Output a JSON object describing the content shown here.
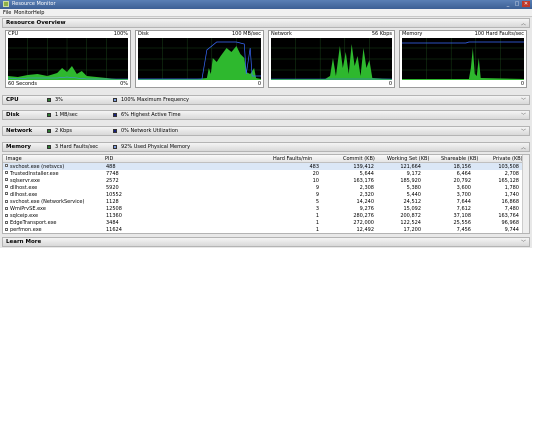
{
  "window": {
    "title": "Resource Monitor",
    "controls": [
      "_",
      "□",
      "✕"
    ]
  },
  "menu": {
    "items": [
      "File",
      "Monitor",
      "Help"
    ]
  },
  "overview": {
    "title": "Resource Overview",
    "graphs": {
      "cpu": {
        "title": "CPU",
        "top_right": "100%",
        "bottom_left": "60 Seconds",
        "bottom_right": "0%"
      },
      "disk": {
        "title": "Disk",
        "top_right": "100 MB/sec",
        "bottom_right": "0"
      },
      "network": {
        "title": "Network",
        "top_right": "56 Kbps",
        "bottom_right": "0"
      },
      "memory": {
        "title": "Memory",
        "top_right": "100 Hard Faults/sec",
        "bottom_right": "0"
      }
    }
  },
  "sections": {
    "cpu": {
      "title": "CPU",
      "stat1": "3%",
      "stat2": "100% Maximum Frequency",
      "color1": "#2e7d32",
      "color2": "#3f5fbf"
    },
    "disk": {
      "title": "Disk",
      "stat1": "1 MB/sec",
      "stat2": "6% Highest Active Time",
      "color1": "#2e7d32",
      "color2": "#1a237e"
    },
    "network": {
      "title": "Network",
      "stat1": "2 Kbps",
      "stat2": "0% Network Utilization",
      "color1": "#2e7d32",
      "color2": "#1a237e"
    },
    "memory": {
      "title": "Memory",
      "stat1": "3 Hard Faults/sec",
      "stat2": "92% Used Physical Memory",
      "color1": "#2e7d32",
      "color2": "#3f5fbf"
    },
    "learn": {
      "title": "Learn More"
    }
  },
  "table": {
    "columns": [
      "Image",
      "PID",
      "Hard Faults/min",
      "Commit (KB)",
      "Working Set (KB)",
      "Shareable (KB)",
      "Private (KB)"
    ],
    "rows": [
      [
        "svchost.exe (netsvcs)",
        "488",
        "483",
        "139,412",
        "121,664",
        "18,156",
        "103,508"
      ],
      [
        "TrustedInstaller.exe",
        "7748",
        "20",
        "5,644",
        "9,172",
        "6,464",
        "2,708"
      ],
      [
        "sqlservr.exe",
        "2572",
        "10",
        "163,176",
        "185,920",
        "20,792",
        "165,128"
      ],
      [
        "dllhost.exe",
        "5920",
        "9",
        "2,308",
        "5,380",
        "3,600",
        "1,780"
      ],
      [
        "dllhost.exe",
        "10552",
        "9",
        "2,320",
        "5,440",
        "3,700",
        "1,740"
      ],
      [
        "svchost.exe (NetworkService)",
        "1128",
        "5",
        "14,240",
        "24,512",
        "7,644",
        "16,868"
      ],
      [
        "WmiPrvSE.exe",
        "12508",
        "3",
        "9,276",
        "15,092",
        "7,612",
        "7,480"
      ],
      [
        "sqlceip.exe",
        "11360",
        "1",
        "280,276",
        "200,872",
        "37,108",
        "163,764"
      ],
      [
        "EdgeTransport.exe",
        "3484",
        "1",
        "272,000",
        "122,524",
        "25,556",
        "96,968"
      ],
      [
        "perfmon.exe",
        "11624",
        "1",
        "12,492",
        "17,200",
        "7,456",
        "9,744"
      ]
    ]
  }
}
